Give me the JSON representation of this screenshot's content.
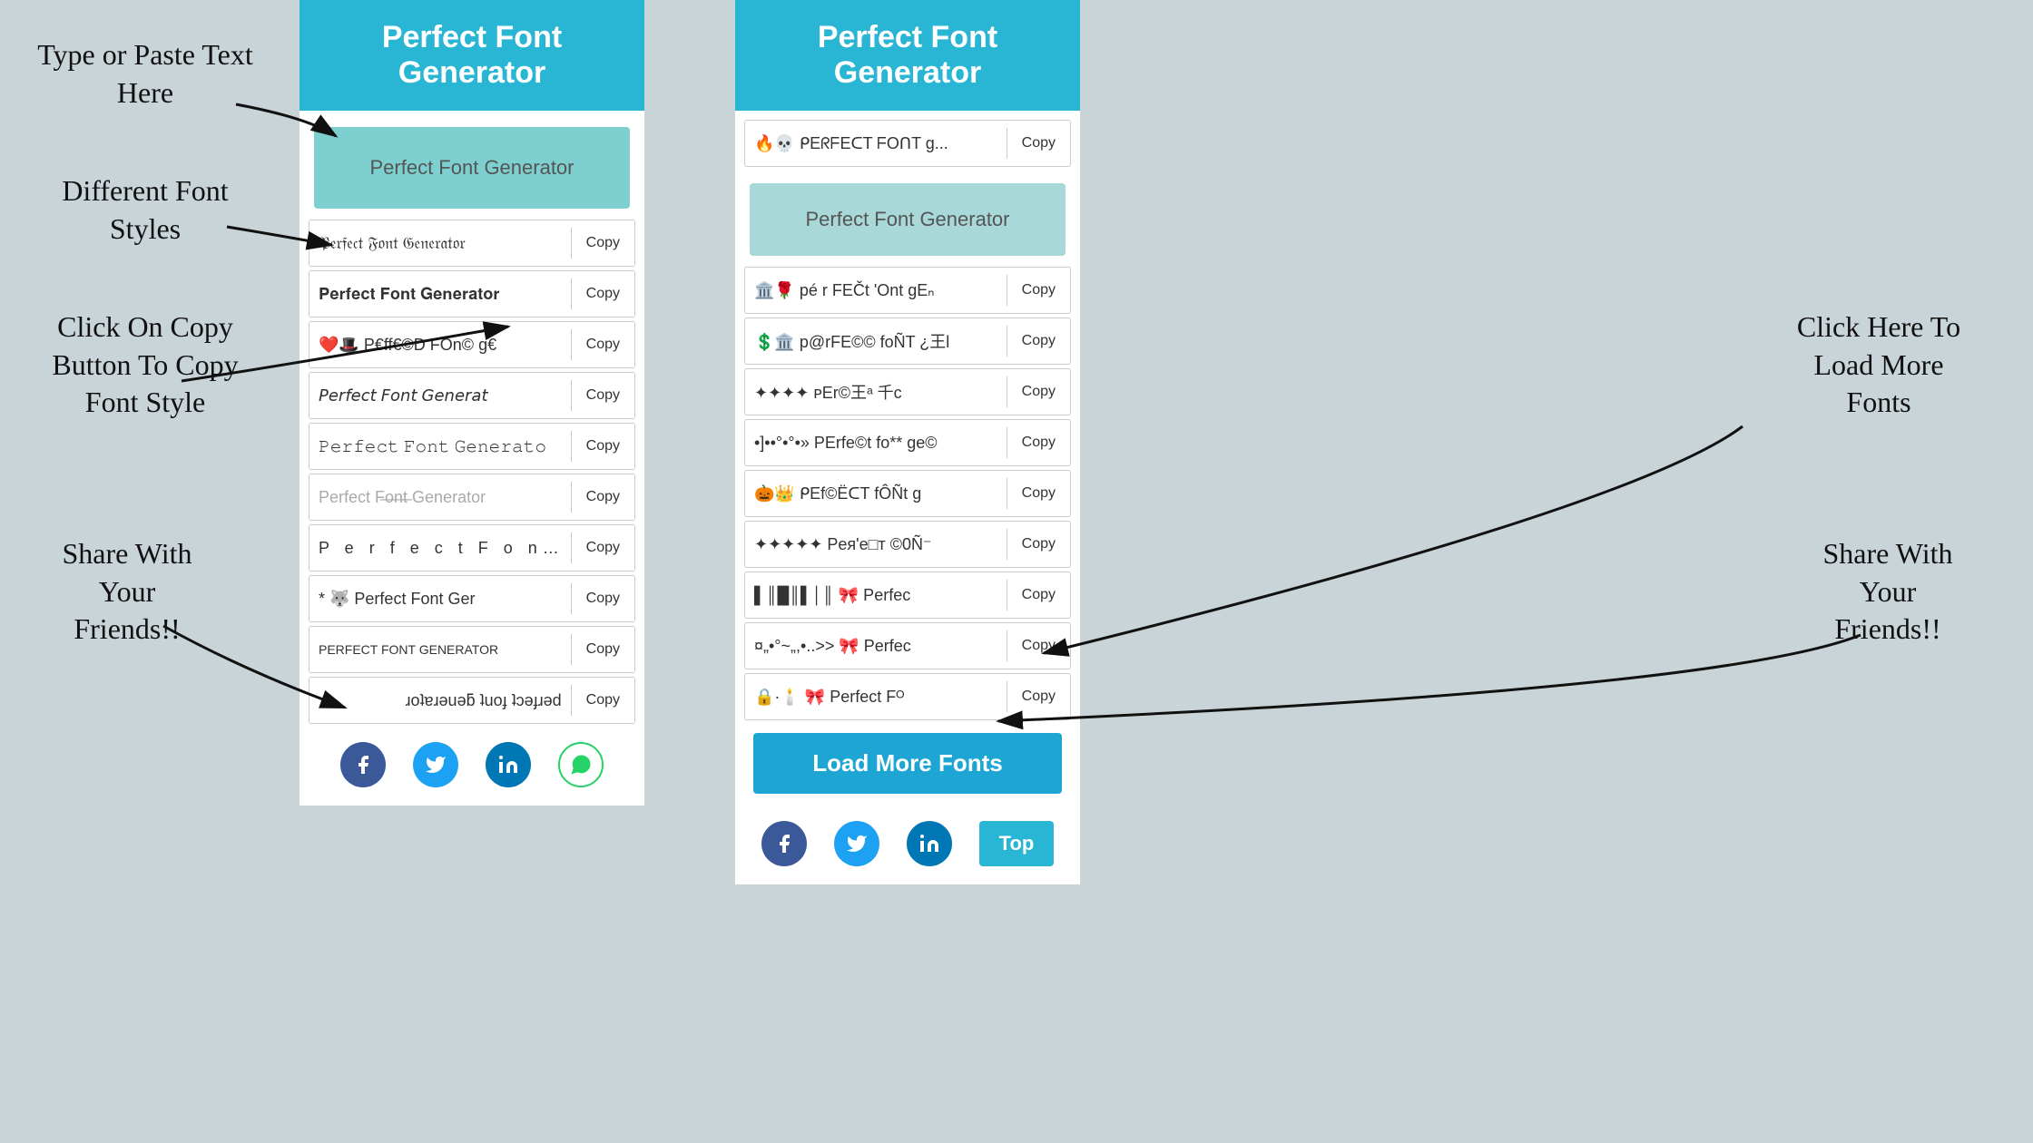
{
  "app": {
    "title": "Perfect Font Generator",
    "bg_color": "#c8d4d8"
  },
  "annotations": {
    "type_paste": "Type or Paste Text\nHere",
    "different_fonts": "Different Font\nStyles",
    "click_copy": "Click On Copy\nButton To Copy\nFont Style",
    "share_left": "Share With\nYour\nFriends!!",
    "click_load": "Click Here To\nLoad More\nFonts",
    "share_right": "Share With\nYour\nFriends!!"
  },
  "left_panel": {
    "header": "Perfect Font Generator",
    "input_placeholder": "Perfect Font Generator",
    "font_rows": [
      {
        "text": "𝔓𝔢𝔯𝔣𝔢𝔠𝔱 𝔉𝔬𝔫𝔱 𝔊𝔢𝔫𝔢𝔯𝔞𝔱𝔬𝔯",
        "copy": "Copy",
        "style": "fraktur"
      },
      {
        "text": "𝐏𝐞𝐫𝐟𝐞𝐜𝐭 𝐅𝐨𝐧𝐭 𝐆𝐞𝐧𝐞𝐫𝐚𝐭𝐨𝐫",
        "copy": "Copy",
        "style": "bold"
      },
      {
        "text": "❤️🎩 P€ff€©D FOn© g€",
        "copy": "Copy",
        "style": "emoji1"
      },
      {
        "text": "𝘗𝘦𝘳𝘧𝘦𝘤𝘵 𝘍𝘰𝘯𝘵 𝘎𝘦𝘯𝘦𝘳𝘢𝘵",
        "copy": "Copy",
        "style": "italic"
      },
      {
        "text": "𝙿𝚎𝚛𝚏𝚎𝚌𝚝 𝙵𝚘𝚗𝚝 𝙶𝚎𝚗𝚎𝚛𝚊𝚝𝚘",
        "copy": "Copy",
        "style": "mono"
      },
      {
        "text": "Perfect Fo̶n̶t̶ Generator",
        "copy": "Copy",
        "style": "strikethrough"
      },
      {
        "text": "P e r f e c t  F o n t",
        "copy": "Copy",
        "style": "spaced"
      },
      {
        "text": "* 🐺 Perfect Fᴏnt Ger",
        "copy": "Copy",
        "style": "emoji2"
      },
      {
        "text": "PERFECT FONT GENERATOR",
        "copy": "Copy",
        "style": "caps"
      },
      {
        "text": "ɹoʇɐɹǝuǝƃ ʇuoɟ ʇɔǝɟɹǝd",
        "copy": "Copy",
        "style": "flipped"
      }
    ],
    "share": {
      "facebook": "f",
      "twitter": "t",
      "linkedin": "in",
      "whatsapp": "w"
    }
  },
  "right_panel": {
    "header": "Perfect Font Generator",
    "input_placeholder": "Perfect Font Generator",
    "font_rows": [
      {
        "text": "🔥💀 ᑭEᖇᖴEᑕT ᖴOᑎT g...",
        "copy": "Copy",
        "style": ""
      },
      {
        "text": "🏛️🌹 pé r FEČt 'Ont gEₙ",
        "copy": "Copy",
        "style": ""
      },
      {
        "text": "💲🏛️ p@rFE©© foÑT ¿王l",
        "copy": "Copy",
        "style": ""
      },
      {
        "text": "✦✦✦✦ ᴘEr@王ᵃ 千c",
        "copy": "Copy",
        "style": ""
      },
      {
        "text": "•]••°•°•» PErfe©t fo** ge©",
        "copy": "Copy",
        "style": ""
      },
      {
        "text": "🎃👑 ᑭEf©ЁᑕT fÔÑt g",
        "copy": "Copy",
        "style": ""
      },
      {
        "text": "✦✦✦✦✦ Peя'e□т ©0Ñ⁻",
        "copy": "Copy",
        "style": ""
      },
      {
        "text": "▌║█║▌│║ 🎀 Perfec",
        "copy": "Copy",
        "style": ""
      },
      {
        "text": "¤„•°~„,•..>> 🎀 Perfec",
        "copy": "Copy",
        "style": ""
      },
      {
        "text": "🔒·🕯️ 🎀 Perfect Fᴼ",
        "copy": "Copy",
        "style": ""
      }
    ],
    "load_more": "Load More Fonts",
    "top_btn": "Top",
    "share": {
      "facebook": "f",
      "twitter": "t",
      "linkedin": "in"
    }
  },
  "copy_label": "Copy"
}
